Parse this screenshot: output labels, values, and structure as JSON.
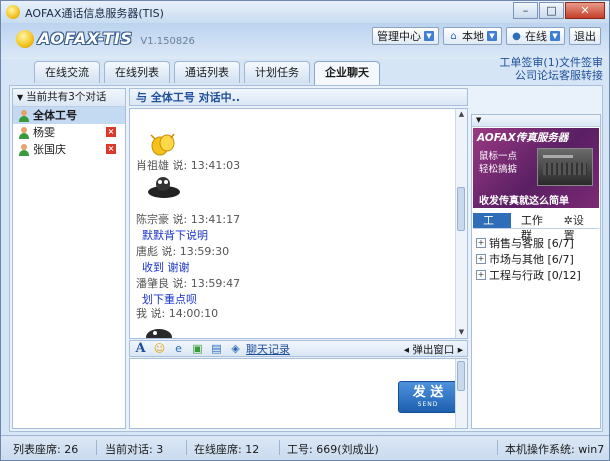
{
  "window": {
    "title": "AOFAX通话信息服务器(TIS)",
    "minimize": "–",
    "maximize": "□",
    "close": "✕"
  },
  "header": {
    "brand": "AOFAX-TIS",
    "version": "V1.150826",
    "buttons": [
      {
        "label": "管理中心"
      },
      {
        "label": "本地"
      },
      {
        "label": "在线"
      },
      {
        "label": "退出"
      }
    ],
    "links": {
      "work_order": "工单签审(1)",
      "file_sign": "文件签审",
      "forum": "公司论坛",
      "service": "客服转接"
    }
  },
  "tabs": [
    {
      "label": "在线交流"
    },
    {
      "label": "在线列表"
    },
    {
      "label": "通话列表"
    },
    {
      "label": "计划任务"
    },
    {
      "label": "企业聊天",
      "active": true
    }
  ],
  "left_panel": {
    "header": "当前共有3个对话",
    "contacts": [
      {
        "name": "全体工号",
        "selected": true
      },
      {
        "name": "杨雯"
      },
      {
        "name": "张国庆"
      }
    ]
  },
  "chat": {
    "title": "与 全体工号 对话中..",
    "messages": [
      {
        "who": "肖祖雄 说: 13:41:03",
        "text": ""
      },
      {
        "who": "陈宗豪 说: 13:41:17",
        "text": "默默背下说明"
      },
      {
        "who": "唐彪 说: 13:59:30",
        "text": "收到 谢谢"
      },
      {
        "who": "潘肇良 说: 13:59:47",
        "text": "划下重点呗"
      },
      {
        "who": "我 说: 14:00:10",
        "text": ""
      }
    ],
    "toolbar": {
      "history": "聊天记录",
      "popout": "弹出窗口"
    },
    "send": {
      "label": "发 送",
      "sub": "SEND"
    }
  },
  "right_panel": {
    "ad": {
      "title": "AOFAX传真服务器",
      "line1": "鼠标一点",
      "line2": "轻松搞掂",
      "line3": "收发传真就这么简单"
    },
    "tabs": [
      {
        "label": "工号",
        "active": true
      },
      {
        "label": "工作群"
      },
      {
        "label": "设置"
      }
    ],
    "groups": [
      {
        "label": "销售与客服 [6/7]"
      },
      {
        "label": "市场与其他 [6/7]"
      },
      {
        "label": "工程与行政 [0/12]"
      }
    ]
  },
  "statusbar": {
    "seats": "列表座席: 26",
    "current": "当前对话: 3",
    "online": "在线座席: 12",
    "worker": "工号: 669(刘成业)",
    "os": "本机操作系统: win7"
  },
  "colors": {
    "accent": "#2f6db8",
    "link": "#1f4f9a",
    "message_text": "#1a33cc",
    "delete": "#d93a2a"
  },
  "icons": {
    "clap_emoji": "clap-emoji-icon",
    "sticker": "sticker-icon"
  }
}
